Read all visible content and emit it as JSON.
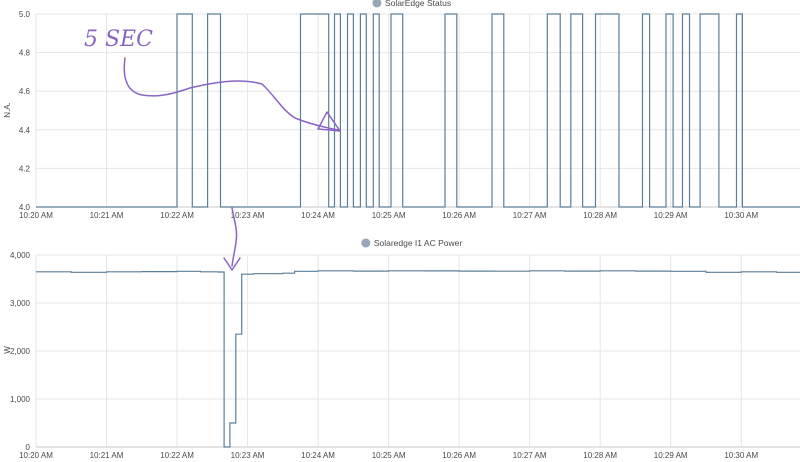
{
  "colors": {
    "series": "#5b7f99",
    "legend_marker": "#98a7b8",
    "annotation": "#8a66c4"
  },
  "annotation": {
    "text": "5 SEC",
    "icon": "hand-drawn-arrow"
  },
  "chart_data": [
    {
      "type": "line",
      "title": "",
      "legend": "SolarEdge Status",
      "legend_placement": "top-center",
      "xlabel": "",
      "ylabel": "N.A.",
      "grid": true,
      "x_ticks": [
        "10:20 AM",
        "10:21 AM",
        "10:22 AM",
        "10:23 AM",
        "10:24 AM",
        "10:25 AM",
        "10:26 AM",
        "10:27 AM",
        "10:28 AM",
        "10:29 AM",
        "10:30 AM"
      ],
      "y_ticks": [
        "4.0",
        "4.2",
        "4.4",
        "4.6",
        "4.8",
        "5.0"
      ],
      "ylim": [
        4.0,
        5.0
      ],
      "xlim": [
        "10:20:00",
        "10:30:50"
      ],
      "step": true,
      "series": [
        {
          "name": "SolarEdge Status",
          "points": [
            [
              "10:20:00",
              4
            ],
            [
              "10:22:00",
              5
            ],
            [
              "10:22:13",
              4
            ],
            [
              "10:22:26",
              5
            ],
            [
              "10:22:37",
              4
            ],
            [
              "10:23:45",
              5
            ],
            [
              "10:24:09",
              4
            ],
            [
              "10:24:14",
              5
            ],
            [
              "10:24:19",
              4
            ],
            [
              "10:24:25",
              5
            ],
            [
              "10:24:30",
              4
            ],
            [
              "10:24:36",
              5
            ],
            [
              "10:24:41",
              4
            ],
            [
              "10:24:47",
              5
            ],
            [
              "10:24:52",
              4
            ],
            [
              "10:25:02",
              5
            ],
            [
              "10:25:12",
              4
            ],
            [
              "10:25:48",
              5
            ],
            [
              "10:25:58",
              4
            ],
            [
              "10:26:28",
              5
            ],
            [
              "10:26:38",
              4
            ],
            [
              "10:27:15",
              5
            ],
            [
              "10:27:26",
              4
            ],
            [
              "10:27:35",
              5
            ],
            [
              "10:27:45",
              4
            ],
            [
              "10:27:56",
              5
            ],
            [
              "10:28:16",
              4
            ],
            [
              "10:28:36",
              5
            ],
            [
              "10:28:42",
              4
            ],
            [
              "10:28:56",
              5
            ],
            [
              "10:29:02",
              4
            ],
            [
              "10:29:10",
              5
            ],
            [
              "10:29:16",
              4
            ],
            [
              "10:29:25",
              5
            ],
            [
              "10:29:41",
              4
            ],
            [
              "10:29:56",
              5
            ],
            [
              "10:30:01",
              4
            ],
            [
              "10:30:50",
              4
            ]
          ]
        }
      ]
    },
    {
      "type": "line",
      "title": "",
      "legend": "Solaredge I1 AC Power",
      "legend_placement": "top-center",
      "xlabel": "",
      "ylabel": "W",
      "grid": true,
      "x_ticks": [
        "10:20 AM",
        "10:21 AM",
        "10:22 AM",
        "10:23 AM",
        "10:24 AM",
        "10:25 AM",
        "10:26 AM",
        "10:27 AM",
        "10:28 AM",
        "10:29 AM",
        "10:30 AM"
      ],
      "y_ticks": [
        "0",
        "1,000",
        "2,000",
        "3,000",
        "4,000"
      ],
      "ylim": [
        0,
        4000
      ],
      "xlim": [
        "10:20:00",
        "10:30:50"
      ],
      "step": true,
      "series": [
        {
          "name": "Solaredge I1 AC Power",
          "points": [
            [
              "10:20:00",
              3650
            ],
            [
              "10:20:30",
              3640
            ],
            [
              "10:21:00",
              3650
            ],
            [
              "10:21:30",
              3655
            ],
            [
              "10:22:00",
              3660
            ],
            [
              "10:22:20",
              3650
            ],
            [
              "10:22:35",
              3645
            ],
            [
              "10:22:40",
              0
            ],
            [
              "10:22:45",
              500
            ],
            [
              "10:22:50",
              2350
            ],
            [
              "10:22:55",
              3600
            ],
            [
              "10:23:05",
              3610
            ],
            [
              "10:23:30",
              3620
            ],
            [
              "10:23:40",
              3660
            ],
            [
              "10:24:00",
              3670
            ],
            [
              "10:24:30",
              3665
            ],
            [
              "10:25:00",
              3670
            ],
            [
              "10:25:30",
              3668
            ],
            [
              "10:26:00",
              3665
            ],
            [
              "10:26:30",
              3662
            ],
            [
              "10:27:00",
              3670
            ],
            [
              "10:27:30",
              3665
            ],
            [
              "10:28:00",
              3670
            ],
            [
              "10:28:30",
              3665
            ],
            [
              "10:29:00",
              3660
            ],
            [
              "10:29:30",
              3640
            ],
            [
              "10:30:00",
              3650
            ],
            [
              "10:30:30",
              3640
            ],
            [
              "10:30:50",
              3640
            ]
          ]
        }
      ]
    }
  ]
}
